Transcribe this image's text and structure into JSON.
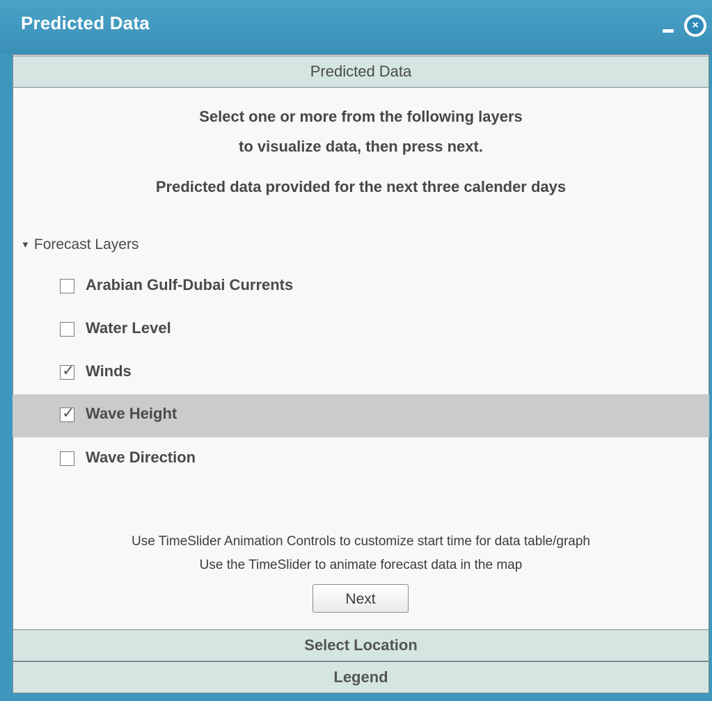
{
  "window": {
    "title": "Predicted Data",
    "minimize_icon": "minimize-icon",
    "close_icon": "close-icon",
    "close_glyph": "×"
  },
  "sections": {
    "predicted_header": "Predicted Data",
    "location_header": "Select Location",
    "legend_header": "Legend"
  },
  "intro": {
    "line1": "Select one or more from the following layers",
    "line2": "to visualize data, then press next.",
    "line3": "Predicted data provided for the next three calender days"
  },
  "forecast_group": {
    "arrow": "▼",
    "label": "Forecast Layers",
    "layers": [
      {
        "label": "Arabian Gulf-Dubai Currents",
        "checked": false
      },
      {
        "label": "Water Level",
        "checked": false
      },
      {
        "label": "Winds",
        "checked": true
      },
      {
        "label": "Wave Height",
        "checked": true
      },
      {
        "label": "Wave Direction",
        "checked": false
      }
    ]
  },
  "notes": {
    "line1": "Use TimeSlider Animation Controls to customize start time for data table/graph",
    "line2": "Use the TimeSlider to animate forecast data in the map"
  },
  "buttons": {
    "next_label": "Next"
  },
  "colors": {
    "titlebar": "#3f97bd",
    "panel_bg": "#f6f9f5",
    "section_header_bg": "#d4e5e2",
    "highlight_row": "#cbcbcb"
  }
}
